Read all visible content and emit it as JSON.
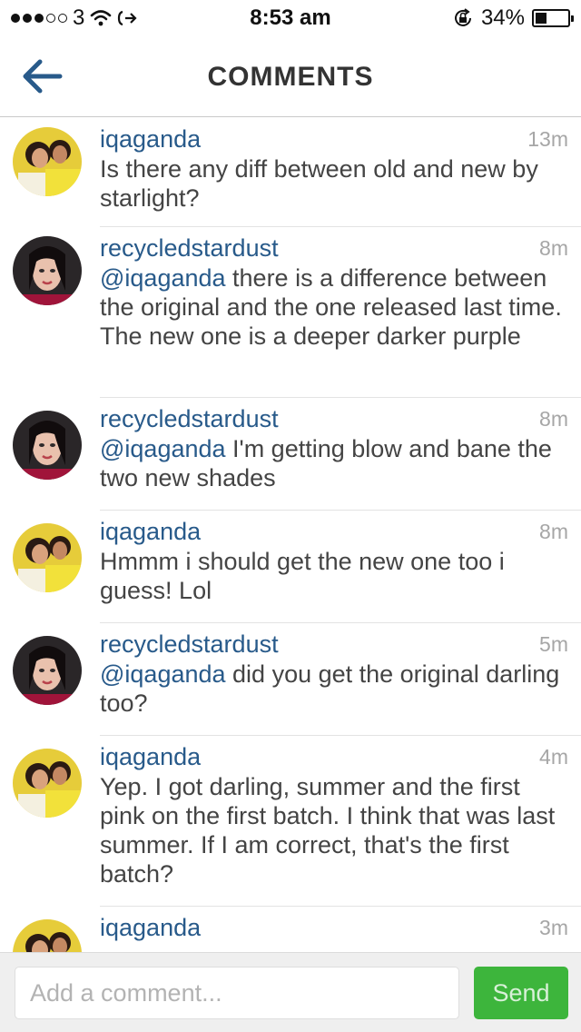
{
  "status_bar": {
    "carrier": "3",
    "time": "8:53 am",
    "battery_percent": "34%",
    "battery_level": 0.34,
    "signal_dots_filled": 3,
    "signal_dots_total": 5
  },
  "header": {
    "title": "COMMENTS",
    "back_icon": "arrow-left-icon"
  },
  "colors": {
    "username": "#285a8a",
    "timestamp": "#a6a6a6",
    "send_button": "#3db53c",
    "back_arrow": "#285a8a"
  },
  "comments": [
    {
      "user": "iqaganda",
      "time": "13m",
      "mention": "",
      "text": "Is there any diff between old and new by starlight?",
      "avatar": "avatar-yellow"
    },
    {
      "user": "recycledstardust",
      "time": "8m",
      "mention": "@iqaganda",
      "text": " there is a difference between the original and the one released last time. The new one is a deeper darker purple",
      "avatar": "avatar-dark"
    },
    {
      "user": "recycledstardust",
      "time": "8m",
      "mention": "@iqaganda",
      "text": " I'm getting blow and bane the two new shades",
      "avatar": "avatar-dark"
    },
    {
      "user": "iqaganda",
      "time": "8m",
      "mention": "",
      "text": "Hmmm i should get the new one too i guess! Lol",
      "avatar": "avatar-yellow"
    },
    {
      "user": "recycledstardust",
      "time": "5m",
      "mention": "@iqaganda",
      "text": " did you get the original darling too?",
      "avatar": "avatar-dark"
    },
    {
      "user": "iqaganda",
      "time": "4m",
      "mention": "",
      "text": "Yep. I got darling, summer and the first pink on the first batch. I think that was last summer. If I am correct, that's the first batch?",
      "avatar": "avatar-yellow"
    },
    {
      "user": "iqaganda",
      "time": "3m",
      "mention": "",
      "text": "",
      "avatar": "avatar-yellow"
    }
  ],
  "compose": {
    "placeholder": "Add a comment...",
    "value": "",
    "send_label": "Send"
  }
}
